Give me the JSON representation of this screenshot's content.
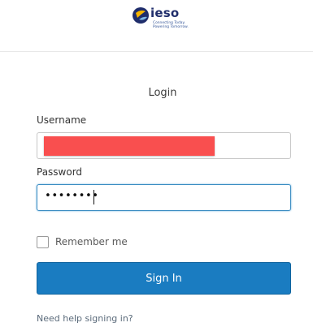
{
  "logo": {
    "wordmark": "ieso",
    "tagline_1": "Connecting Today.",
    "tagline_2": "Powering Tomorrow."
  },
  "form": {
    "title": "Login",
    "username_label": "Username",
    "username_value": "",
    "password_label": "Password",
    "password_value": "••••••••",
    "remember_label": "Remember me",
    "remember_checked": false,
    "signin_label": "Sign In",
    "help_link": "Need help signing in?"
  },
  "colors": {
    "primary_button": "#1a7cc1",
    "focus_border": "#3a8cc2",
    "redaction": "#f94f4f",
    "logo_navy": "#1f2d6b"
  }
}
